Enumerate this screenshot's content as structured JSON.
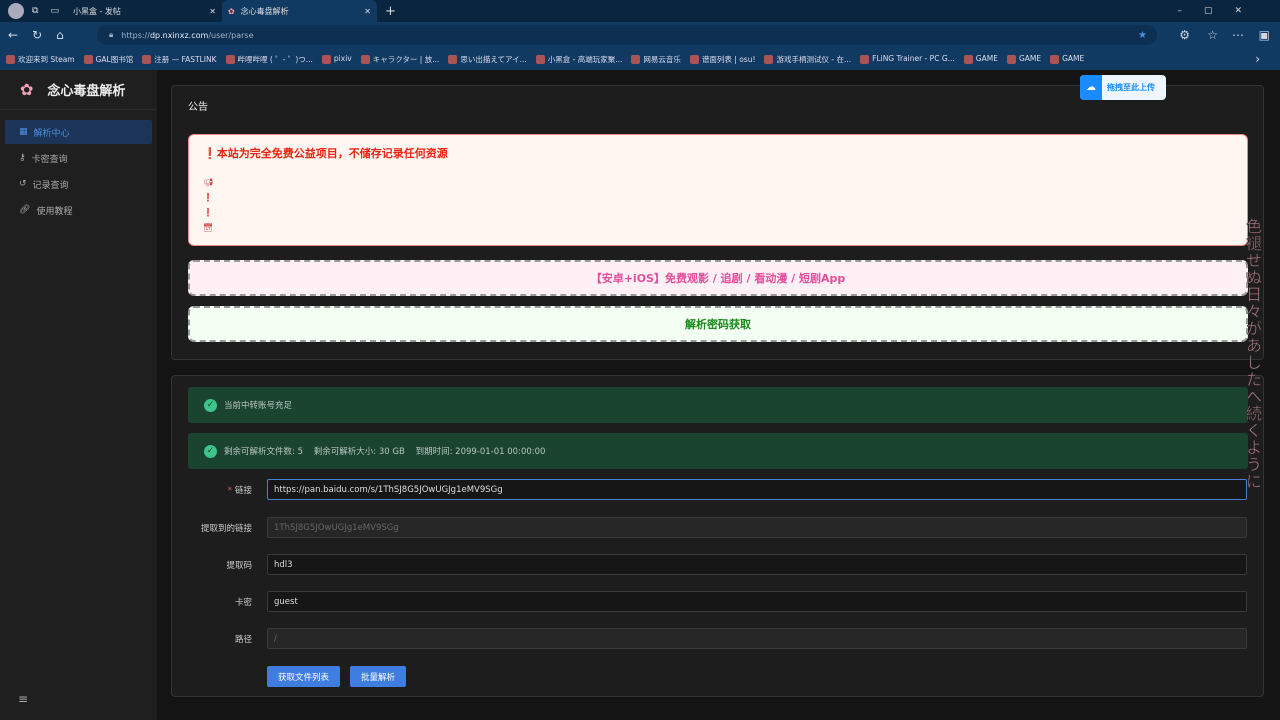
{
  "browser": {
    "tabs": [
      {
        "label": "小黑盒 - 发帖"
      },
      {
        "label": "念心毒盘解析"
      }
    ],
    "url_prefix": "https://",
    "url_host": "dp.nxinxz.com",
    "url_path": "/user/parse",
    "bookmarks": [
      "欢迎来到 Steam",
      "GAL图书馆",
      "注册 — FASTLINK",
      "哔哩哔哩 ( ゜- ゜)つ...",
      "pixiv",
      "キャラクター | 放...",
      "思い出描えてアイ...",
      "小黑盒 - 高端玩家聚...",
      "网易云音乐",
      "谱面列表 | osu!",
      "游戏手柄测试仪 - 在...",
      "FLiNG Trainer - PC G...",
      "GAME",
      "GAME",
      "GAME"
    ]
  },
  "sidebar": {
    "title": "念心毒盘解析",
    "items": [
      {
        "label": "解析中心"
      },
      {
        "label": "卡密查询"
      },
      {
        "label": "记录查询"
      },
      {
        "label": "使用教程"
      }
    ]
  },
  "notice": {
    "title": "公告",
    "headline": "本站为完全免费公益项目，不储存记录任何资源",
    "app_banner": "【安卓+iOS】免费观影 / 追剧 / 看动漫 / 短剧App",
    "password_banner": "解析密码获取"
  },
  "status": {
    "account": "当前中转账号充足",
    "quota": "剩余可解析文件数: 5    剩余可解析大小: 30 GB    到期时间: 2099-01-01 00:00:00"
  },
  "form": {
    "link_label": "链接",
    "link_value": "https://pan.baidu.com/s/1ThSJ8G5JOwUGJg1eMV9SGg",
    "extracted_label": "提取到的链接",
    "extracted_value": "1ThSJ8G5JOwUGJg1eMV9SGg",
    "code_label": "提取码",
    "code_value": "hdl3",
    "card_label": "卡密",
    "card_value": "guest",
    "path_label": "路径",
    "path_value": "/",
    "get_list": "获取文件列表",
    "batch": "批量解析"
  },
  "overlay": {
    "upload": "拖拽至此上传",
    "lyric": "色褪せぬ日々があしたへ続くように"
  },
  "colors": {
    "accent": "#3f7de0",
    "success": "#1a4330",
    "danger": "#e21"
  }
}
